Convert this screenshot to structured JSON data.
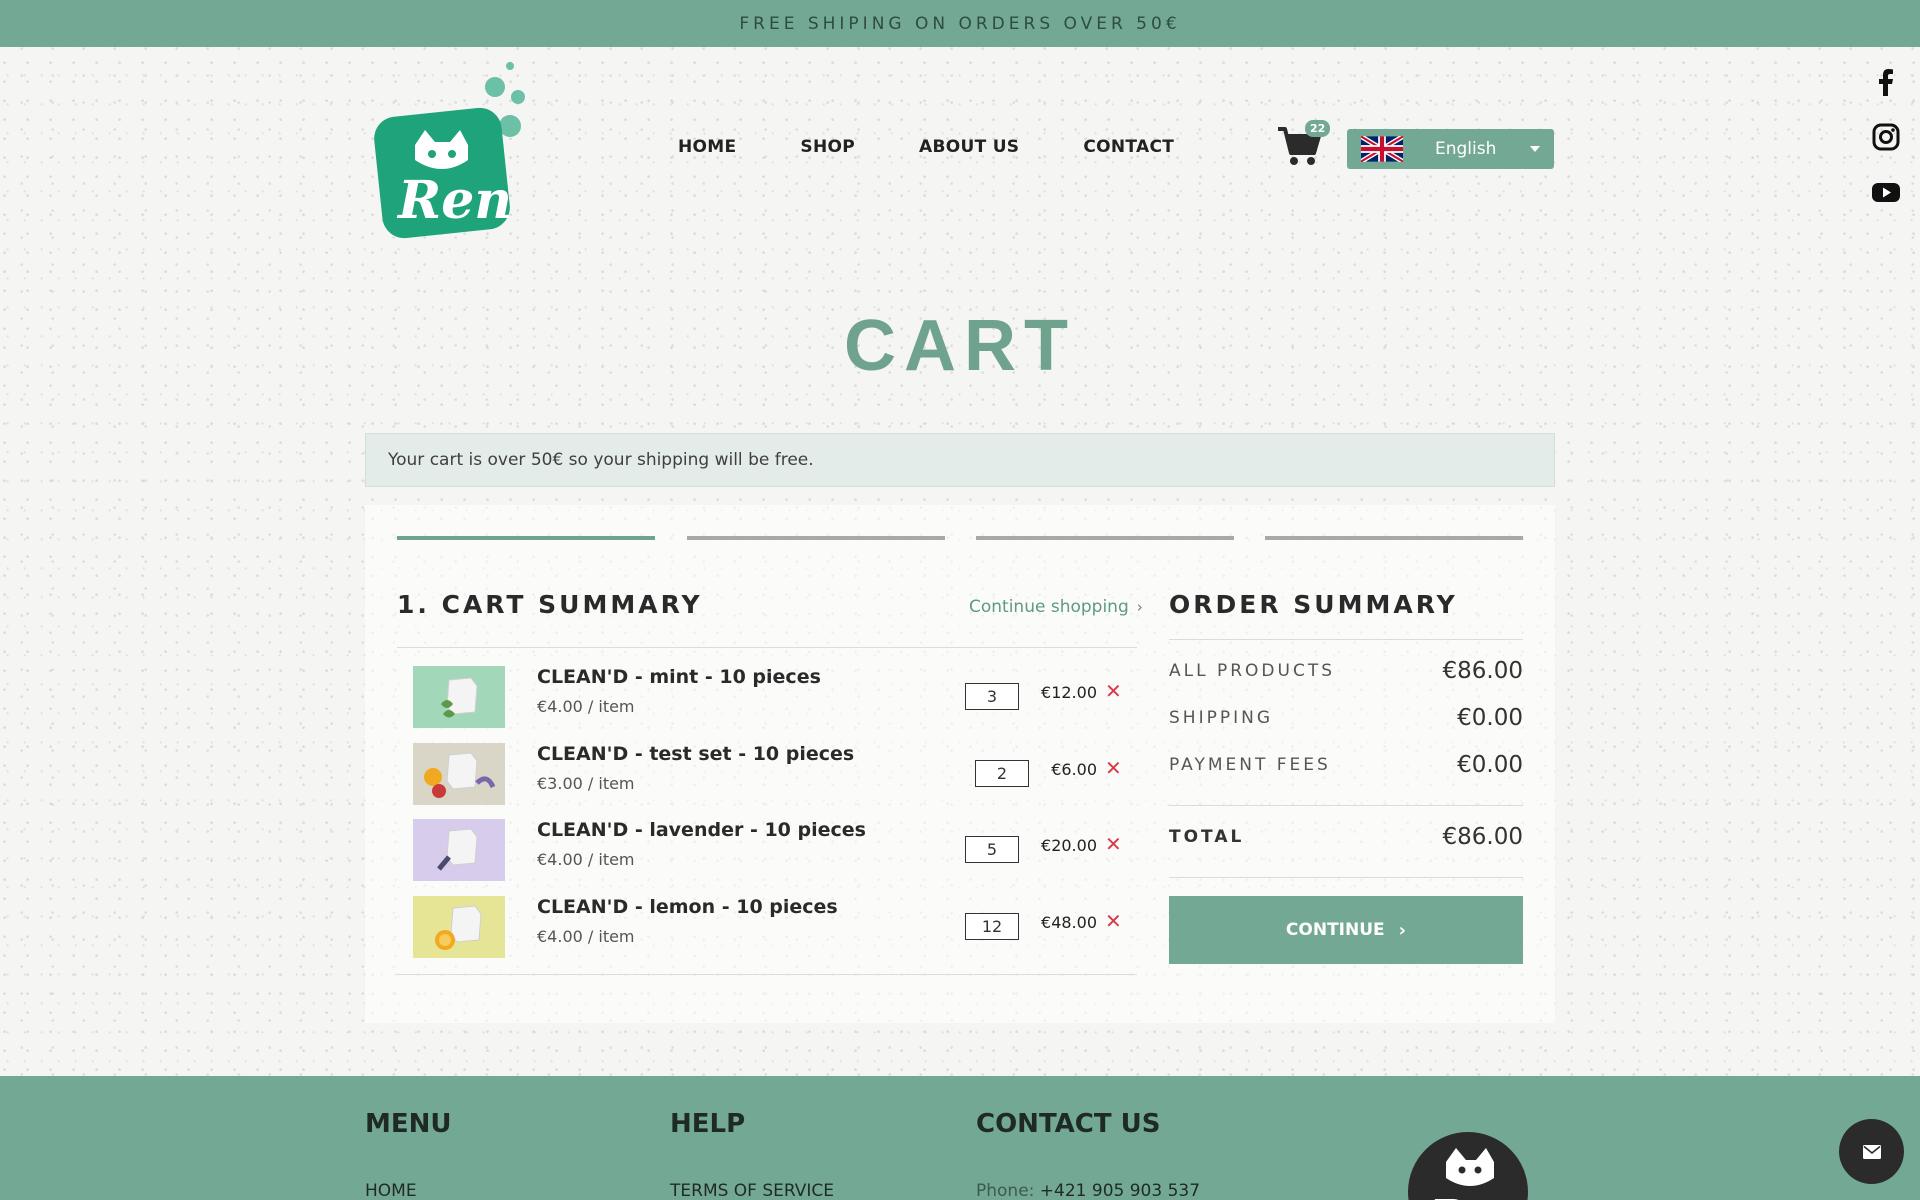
{
  "banner": {
    "text": "FREE SHIPING ON ORDERS OVER 50€"
  },
  "header": {
    "logo_alt": "Ren",
    "nav": [
      "HOME",
      "SHOP",
      "ABOUT US",
      "CONTACT"
    ],
    "cart_count": "22",
    "language": "English"
  },
  "social": [
    "facebook-icon",
    "instagram-icon",
    "youtube-icon"
  ],
  "page": {
    "title": "CART"
  },
  "notice": {
    "text": "Your cart is over 50€ so your shipping will be free."
  },
  "steps": {
    "count": 4,
    "active": 1
  },
  "cart_summary": {
    "title": "1. CART SUMMARY",
    "continue_link": "Continue shopping",
    "items": [
      {
        "name": "CLEAN'D - mint - 10 pieces",
        "unit_price": "€4.00 / item",
        "qty": "3",
        "total": "€12.00",
        "thumb_color": "#a3d7b9"
      },
      {
        "name": "CLEAN'D - test set - 10 pieces",
        "unit_price": "€3.00 / item",
        "qty": "2",
        "total": "€6.00",
        "thumb_color": "#d9d6c8"
      },
      {
        "name": "CLEAN'D - lavender - 10 pieces",
        "unit_price": "€4.00 / item",
        "qty": "5",
        "total": "€20.00",
        "thumb_color": "#d8ccec"
      },
      {
        "name": "CLEAN'D - lemon - 10 pieces",
        "unit_price": "€4.00 / item",
        "qty": "12",
        "total": "€48.00",
        "thumb_color": "#e6e596"
      }
    ]
  },
  "order_summary": {
    "title": "ORDER SUMMARY",
    "all_products_label": "ALL PRODUCTS",
    "all_products_value": "€86.00",
    "shipping_label": "SHIPPING",
    "shipping_value": "€0.00",
    "payment_fees_label": "PAYMENT FEES",
    "payment_fees_value": "€0.00",
    "total_label": "TOTAL",
    "total_value": "€86.00",
    "continue_label": "CONTINUE"
  },
  "footer": {
    "menu_heading": "MENU",
    "help_heading": "HELP",
    "contact_heading": "CONTACT US",
    "menu_first": "HOME",
    "help_first": "TERMS OF SERVICE",
    "phone_label": "Phone:",
    "phone_value": "+421 905 903 537"
  },
  "colors": {
    "accent": "#73a994",
    "title": "#6fa38e",
    "remove": "#d93a4a"
  }
}
